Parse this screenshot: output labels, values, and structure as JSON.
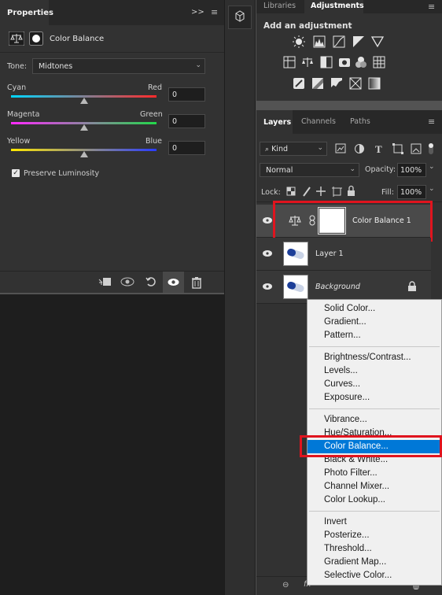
{
  "properties": {
    "tab": "Properties",
    "collapse": ">>",
    "title": "Color Balance",
    "tone_label": "Tone:",
    "tone_value": "Midtones",
    "sliders": [
      {
        "left": "Cyan",
        "right": "Red",
        "value": "0",
        "position": 0.5
      },
      {
        "left": "Magenta",
        "right": "Green",
        "value": "0",
        "position": 0.5
      },
      {
        "left": "Yellow",
        "right": "Blue",
        "value": "0",
        "position": 0.5
      }
    ],
    "preserve_label": "Preserve Luminosity",
    "preserve_checked": true
  },
  "adjustments_panel": {
    "tabs": [
      "Libraries",
      "Adjustments"
    ],
    "heading": "Add an adjustment"
  },
  "layers_panel": {
    "tabs": [
      "Layers",
      "Channels",
      "Paths"
    ],
    "filter_kind": "Kind",
    "blend_mode": "Normal",
    "opacity_label": "Opacity:",
    "opacity_value": "100%",
    "lock_label": "Lock:",
    "fill_label": "Fill:",
    "fill_value": "100%",
    "layers": [
      {
        "name": "Color Balance 1"
      },
      {
        "name": "Layer 1"
      },
      {
        "name": "Background"
      }
    ]
  },
  "menu": {
    "groups": [
      [
        "Solid Color...",
        "Gradient...",
        "Pattern..."
      ],
      [
        "Brightness/Contrast...",
        "Levels...",
        "Curves...",
        "Exposure..."
      ],
      [
        "Vibrance...",
        "Hue/Saturation...",
        "Color Balance...",
        "Black & White...",
        "Photo Filter...",
        "Channel Mixer...",
        "Color Lookup..."
      ],
      [
        "Invert",
        "Posterize...",
        "Threshold...",
        "Gradient Map...",
        "Selective Color..."
      ]
    ],
    "selected": "Color Balance..."
  },
  "colors": {
    "highlight": "#e0141e",
    "menu_selection": "#0078d7",
    "panel": "#323232"
  }
}
